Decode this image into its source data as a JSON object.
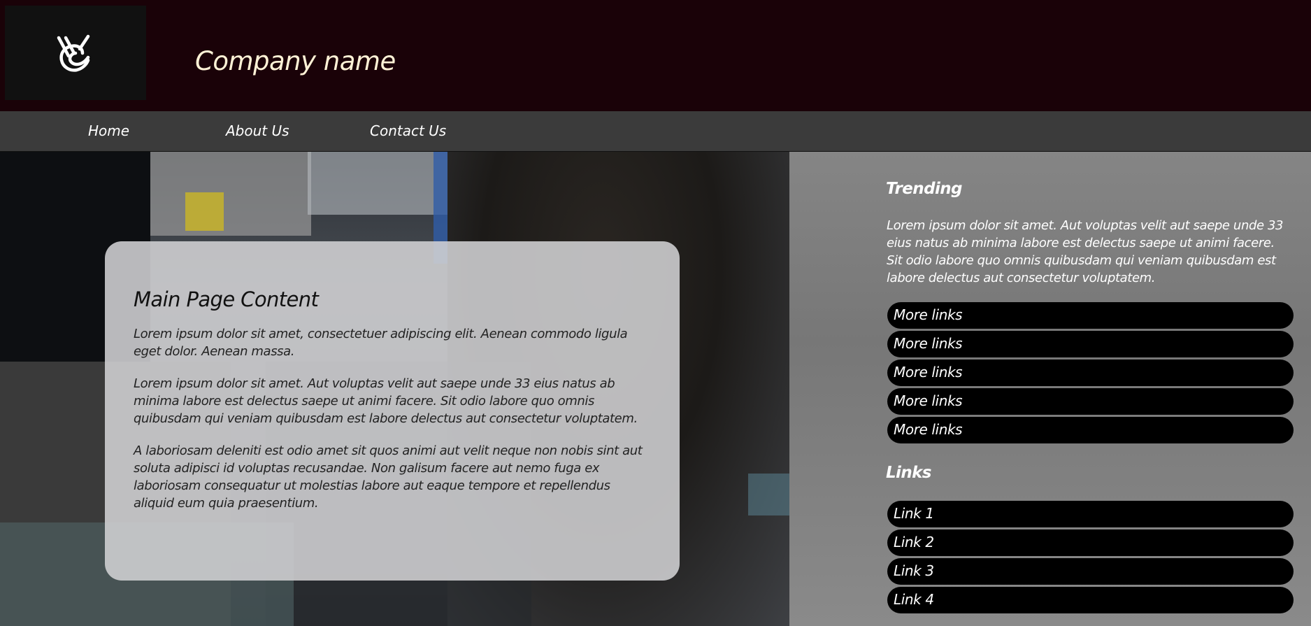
{
  "header": {
    "logo_icon": "vc-monogram-icon",
    "company_name": "Company name"
  },
  "nav": {
    "items": [
      {
        "label": "Home"
      },
      {
        "label": "About Us"
      },
      {
        "label": "Contact Us"
      }
    ]
  },
  "main": {
    "title": "Main Page Content",
    "paragraphs": [
      "Lorem ipsum dolor sit amet, consectetuer adipiscing elit. Aenean commodo ligula eget dolor. Aenean massa.",
      "Lorem ipsum dolor sit amet. Aut voluptas velit aut saepe unde 33 eius natus ab minima labore est delectus saepe ut animi facere. Sit odio labore quo omnis quibusdam qui veniam quibusdam est labore delectus aut consectetur voluptatem.",
      "A laboriosam deleniti est odio amet sit quos animi aut velit neque non nobis sint aut soluta adipisci id voluptas recusandae. Non galisum facere aut nemo fuga ex laboriosam consequatur ut molestias labore aut eaque tempore et repellendus aliquid eum quia praesentium."
    ]
  },
  "sidebar": {
    "trending_heading": "Trending",
    "trending_text": "Lorem ipsum dolor sit amet. Aut voluptas velit aut saepe unde 33 eius natus ab minima labore est delectus saepe ut animi facere. Sit odio labore quo omnis quibusdam qui veniam quibusdam est labore delectus aut consectetur voluptatem.",
    "more_links": [
      "More links",
      "More links",
      "More links",
      "More links",
      "More links"
    ],
    "links_heading": "Links",
    "links": [
      "Link 1",
      "Link 2",
      "Link 3",
      "Link 4"
    ]
  },
  "colors": {
    "header_bg": "#1a0208",
    "nav_bg": "#3b3b3b",
    "company_name": "#fff2d6",
    "pill_bg": "#000000",
    "sidebar_bg": "#808080"
  }
}
